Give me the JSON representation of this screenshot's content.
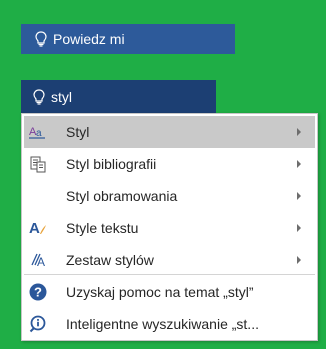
{
  "search": {
    "placeholder_label": "Powiedz mi",
    "query": "styl",
    "bulb_icon": "lightbulb-icon"
  },
  "menu": {
    "items": [
      {
        "label": "Styl",
        "icon": "style-aa-icon",
        "submenu": true,
        "hovered": true
      },
      {
        "label": "Styl bibliografii",
        "icon": "bibliography-icon",
        "submenu": true
      },
      {
        "label": "Styl obramowania",
        "icon": "",
        "submenu": true
      },
      {
        "label": "Style tekstu",
        "icon": "text-style-icon",
        "submenu": true
      },
      {
        "label": "Zestaw stylów",
        "icon": "style-set-icon",
        "submenu": true
      }
    ],
    "help_items": [
      {
        "label": "Uzyskaj pomoc na temat „styl”",
        "icon": "help-icon"
      },
      {
        "label": "Inteligentne wyszukiwanie „st...",
        "icon": "smart-lookup-icon"
      }
    ]
  },
  "colors": {
    "background": "#1fae46",
    "tellme_bar": "#2d5a9a",
    "tellme_active": "#1c3f73",
    "hover": "#c9c9c9",
    "accent_blue": "#2b579a"
  }
}
